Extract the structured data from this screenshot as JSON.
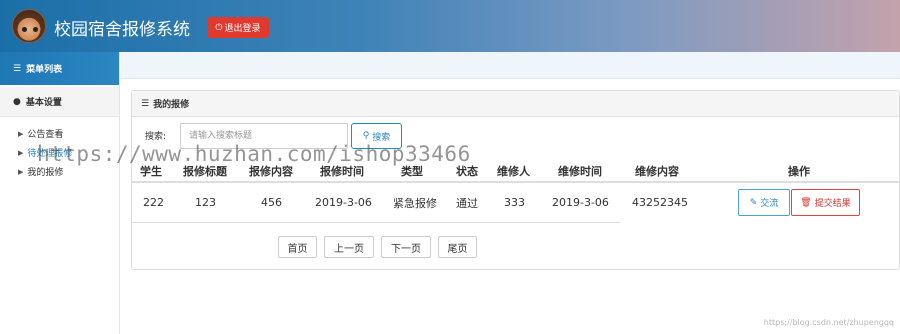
{
  "header": {
    "app_title": "校园宿舍报修系统",
    "logout_label": "退出登录",
    "logout_icon": "power-icon"
  },
  "sidebar": {
    "menu_title": "菜单列表",
    "group_label": "基本设置",
    "items": [
      {
        "label": "公告查看"
      },
      {
        "label": "待处理报修"
      },
      {
        "label": "我的报修"
      }
    ]
  },
  "panel": {
    "title": "我的报修",
    "search_label": "搜索:",
    "search_placeholder": "请输入搜索标题",
    "search_button": "搜索"
  },
  "table": {
    "headers": [
      "学生",
      "报修标题",
      "报修内容",
      "报修时间",
      "类型",
      "状态",
      "维修人",
      "维修时间",
      "维修内容",
      "操作"
    ],
    "rows": [
      {
        "student": "222",
        "title": "123",
        "content": "456",
        "time": "2019-3-06",
        "type": "紧急报修",
        "status": "通过",
        "repairer": "333",
        "repair_time": "2019-3-06",
        "repair_content": "43252345"
      }
    ],
    "action_exchange": "交流",
    "action_submit": "提交结果"
  },
  "pager": {
    "first": "首页",
    "prev": "上一页",
    "next": "下一页",
    "last": "尾页"
  },
  "watermark": "https://www.huzhan.com/ishop33466",
  "footer_mark": "https://blog.csdn.net/zhupengqq",
  "colors": {
    "accent_blue": "#2a86c2",
    "danger_red": "#e03a2f"
  }
}
